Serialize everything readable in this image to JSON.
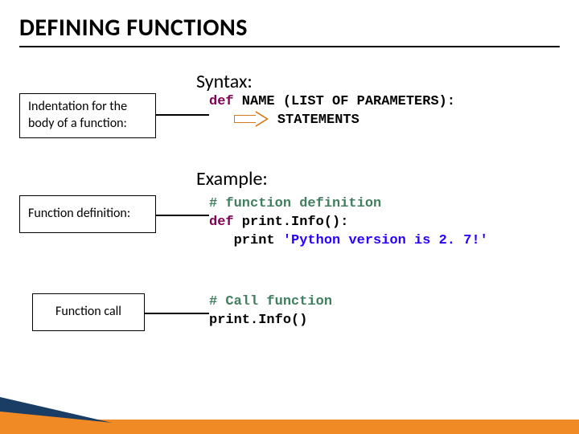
{
  "title": "DEFINING FUNCTIONS",
  "sections": {
    "syntax_heading": "Syntax:",
    "example_heading": "Example:"
  },
  "callouts": {
    "indentation": "Indentation for the body of a function:",
    "definition": "Function definition:",
    "call": "Function call"
  },
  "code": {
    "syntax": {
      "def_kw": "def",
      "sig": " NAME (LIST OF PARAMETERS):",
      "stmt": "STATEMENTS"
    },
    "example_def": {
      "comment": "# function definition",
      "def_kw": "def",
      "sig": " print.Info():",
      "print_kw": "   print ",
      "string": "'Python version is 2. 7!'"
    },
    "example_call": {
      "comment": "# Call function",
      "call": "print.Info()"
    }
  }
}
